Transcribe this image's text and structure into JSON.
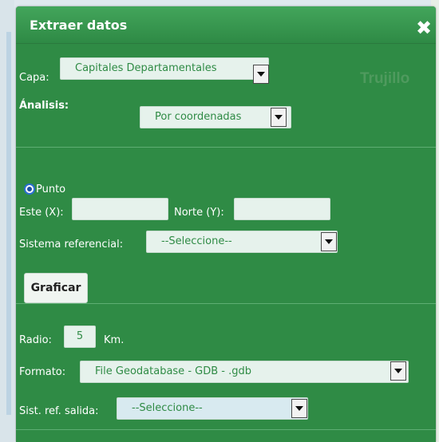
{
  "dialog": {
    "title": "Extraer datos",
    "close_icon": "close-icon"
  },
  "background": {
    "watermark": "Trujillo"
  },
  "capa": {
    "label": "Capa:",
    "value": "Capitales Departamentales"
  },
  "analisis": {
    "label": "Ánalisis:",
    "value": "Por coordenadas"
  },
  "punto": {
    "radio_label": "Punto",
    "este_label": "Este (X):",
    "este_value": "",
    "norte_label": "Norte (Y):",
    "norte_value": "",
    "sistema_label": "Sistema referencial:",
    "sistema_value": "--Seleccione--",
    "graficar": "Graficar"
  },
  "radio": {
    "label": "Radio:",
    "value": "5",
    "unit": "Km."
  },
  "formato": {
    "label": "Formato:",
    "value": "File Geodatabase - GDB - .gdb"
  },
  "sist_salida": {
    "label": "Sist. ref. salida:",
    "value": "--Seleccione--"
  },
  "colors": {
    "panel": "#2f8b45",
    "header": "#43a55b",
    "field": "#e6f2ec",
    "accent_text": "#2f8b45"
  }
}
